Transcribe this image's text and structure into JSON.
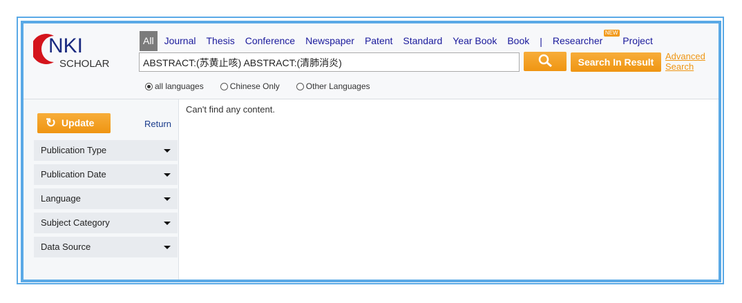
{
  "logo": {
    "brand": "NKI",
    "sub": "SCHOLAR"
  },
  "nav": {
    "items": [
      "All",
      "Journal",
      "Thesis",
      "Conference",
      "Newspaper",
      "Patent",
      "Standard",
      "Year Book",
      "Book"
    ],
    "separator": "|",
    "researcher": "Researcher",
    "new_badge": "NEW",
    "project": "Project"
  },
  "search": {
    "value": "ABSTRACT:(苏黄止咳) ABSTRACT:(清肺消炎)",
    "search_in_result": "Search In Result",
    "advanced": "Advanced",
    "advanced2": "Search"
  },
  "languages": [
    "all languages",
    "Chinese Only",
    "Other Languages"
  ],
  "sidebar": {
    "update": "Update",
    "return": "Return",
    "filters": [
      "Publication Type",
      "Publication Date",
      "Language",
      "Subject Category",
      "Data Source"
    ]
  },
  "content": {
    "message": "Can't find any content."
  },
  "colors": {
    "accent": "#ef9512",
    "border": "#5aa9e6",
    "link": "#1a1a9c"
  }
}
